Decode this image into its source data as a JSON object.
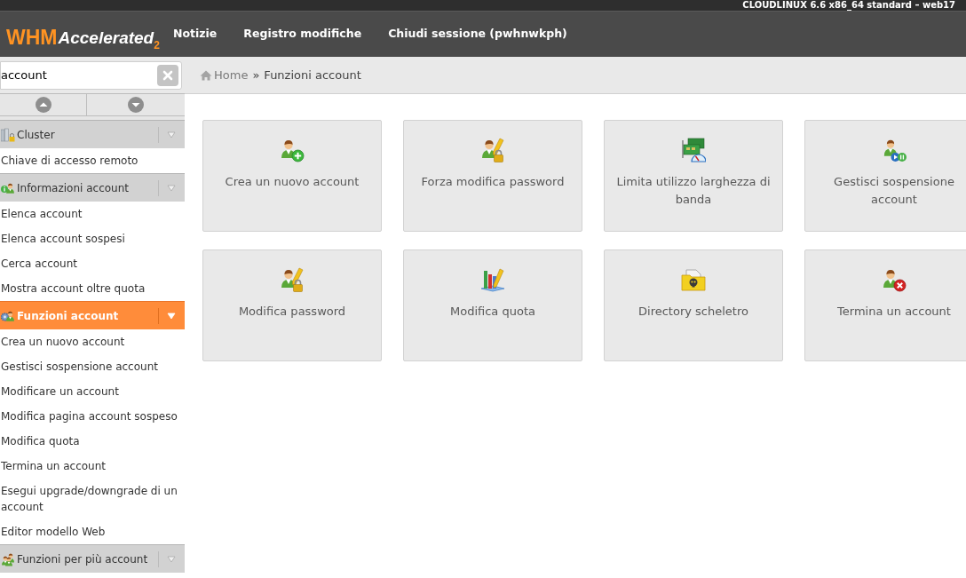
{
  "top_bar": {
    "text": "CLOUDLINUX 6.6 x86_64 standard – web17"
  },
  "header": {
    "logo": {
      "brand": "WHM",
      "product": "Accelerated",
      "version": "2"
    },
    "nav": [
      {
        "label": "Notizie"
      },
      {
        "label": "Registro modifiche"
      },
      {
        "label": "Chiudi sessione (pwhnwkph)"
      }
    ]
  },
  "sidebar": {
    "search": {
      "value": "account"
    },
    "sections": [
      {
        "title": "Cluster",
        "selected": false,
        "items": [
          "Chiave di accesso remoto"
        ]
      },
      {
        "title": "Informazioni account",
        "selected": false,
        "items": [
          "Elenca account",
          "Elenca account sospesi",
          "Cerca account",
          "Mostra account oltre quota"
        ]
      },
      {
        "title": "Funzioni account",
        "selected": true,
        "items": [
          "Crea un nuovo account",
          "Gestisci sospensione account",
          "Modificare un account",
          "Modifica pagina account sospeso",
          "Modifica quota",
          "Termina un account",
          "Esegui upgrade/downgrade di un account",
          "Editor modello Web"
        ]
      },
      {
        "title": "Funzioni per più account",
        "selected": false
      }
    ]
  },
  "breadcrumb": {
    "items": [
      "Home",
      "Funzioni account"
    ],
    "separator": "»"
  },
  "cards": [
    {
      "label": "Crea un nuovo account"
    },
    {
      "label": "Forza modifica password"
    },
    {
      "label": "Limita utilizzo larghezza di banda"
    },
    {
      "label": "Gestisci sospensione account"
    },
    {
      "label": "Modifica password"
    },
    {
      "label": "Modifica quota"
    },
    {
      "label": "Directory scheletro"
    },
    {
      "label": "Termina un account"
    }
  ]
}
